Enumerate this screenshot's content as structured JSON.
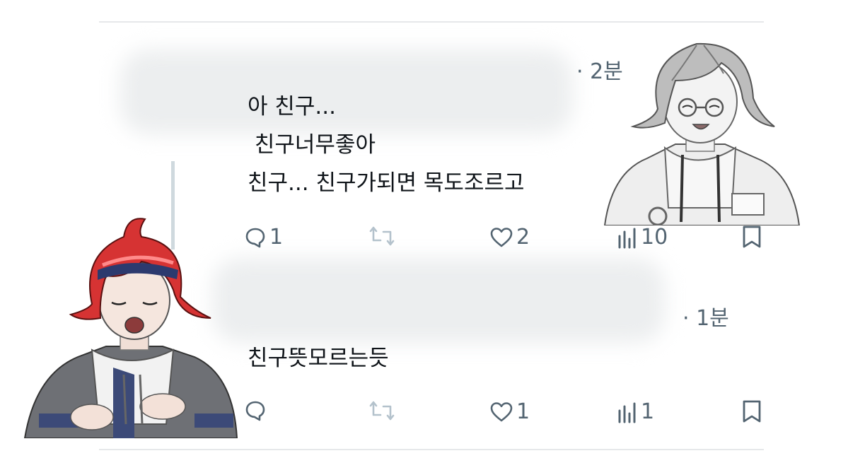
{
  "colors": {
    "divider": "#e6e8ea",
    "icon_gray": "#536471",
    "text": "#0f1419",
    "thread_line": "#cfd9de",
    "red_hair": "#d63333"
  },
  "reply1": {
    "timestamp": "· 2분",
    "lines": [
      "아 친구...",
      " 친구너무좋아",
      "친구... 친구가되면 목도조르고"
    ],
    "actions": {
      "reply_icon": "speech-bubble-icon",
      "reply_count": "1",
      "retweet_icon": "retweet-icon",
      "like_icon": "heart-icon",
      "like_count": "2",
      "views_icon": "bar-chart-icon",
      "views_count": "10",
      "bookmark_icon": "bookmark-icon"
    }
  },
  "reply2": {
    "timestamp": "· 1분",
    "lines": [
      "친구뜻모르는듯"
    ],
    "actions": {
      "reply_count": "",
      "like_count": "1",
      "views_count": "1"
    }
  }
}
